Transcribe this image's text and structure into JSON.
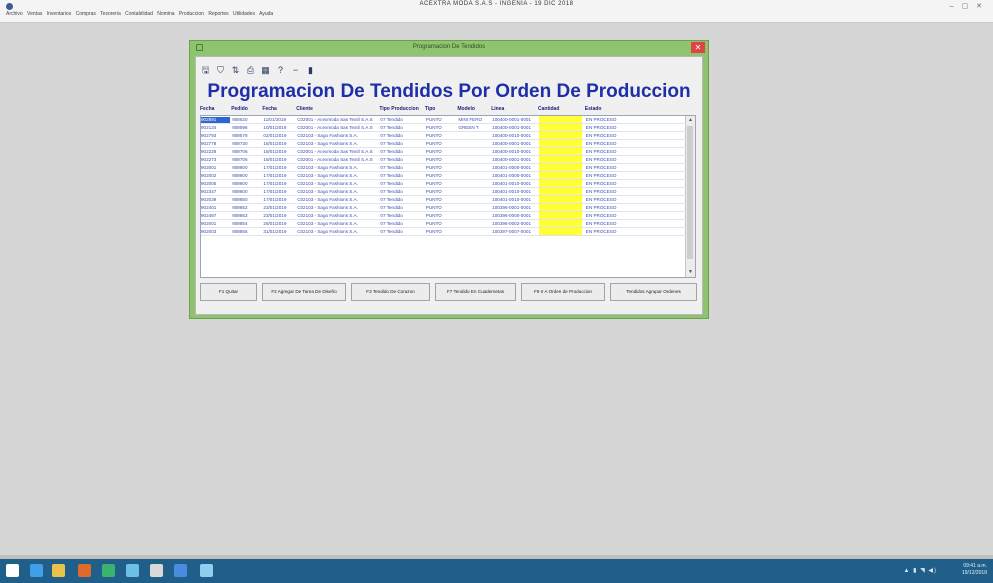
{
  "app": {
    "title": "ACEXTRA MODA  S.A.S    -    INGENIA           -    19 DIC 2018",
    "menu": "Archivo  Ventas  Inventarios  Compras  Tesoreria  Contabilidad  Nomina  Produccion  Reportes  Utilidades  Ayuda",
    "window_controls": "– ▢ ✕"
  },
  "window": {
    "title": "Programacion De Tendidos",
    "close_glyph": "✕"
  },
  "toolbar": {
    "tools": [
      {
        "icon": "save-icon",
        "glyph": "🖫"
      },
      {
        "icon": "filter-icon",
        "glyph": "⛉"
      },
      {
        "icon": "sort-icon",
        "glyph": "⇅"
      },
      {
        "icon": "print-icon",
        "glyph": "⎙"
      },
      {
        "icon": "preview-icon",
        "glyph": "▦"
      },
      {
        "icon": "help-icon",
        "glyph": "?"
      },
      {
        "icon": "minus-icon",
        "glyph": "−"
      },
      {
        "icon": "exit-icon",
        "glyph": "▮"
      }
    ]
  },
  "heading": "Programacion De Tendidos Por Orden De Produccion",
  "table": {
    "columns": [
      "Fecha",
      "Pedido",
      "Fecha",
      "Cliente",
      "Tipo Produccion",
      "Tipo",
      "Modelo",
      "Linea",
      "Cantidad",
      "Estado"
    ],
    "rows": [
      [
        "902891",
        "908620",
        "11/01/2019",
        "C02001 - Acexmoda Sas Textil S.A.S",
        "07 Tendido",
        "PUNTO",
        "MINI FERO",
        "100400-0001-0001",
        "",
        "EN PROCESO"
      ],
      [
        "902134",
        "908596",
        "10/01/2019",
        "C02001 - Acexmoda Sas Textil S.A.S",
        "07 Tendido",
        "PUNTO",
        "GREEN T",
        "100400-0001-0001",
        "",
        "EN PROCESO"
      ],
      [
        "902793",
        "908578",
        "02/01/2019",
        "C02103 - Sago Fashions S.A.",
        "07 Tendido",
        "PUNTO",
        "",
        "100400-0010-0001",
        "",
        "EN PROCESO"
      ],
      [
        "902778",
        "908730",
        "18/01/2019",
        "C02103 - Sago Fashions S.A.",
        "07 Tendido",
        "PUNTO",
        "",
        "100400-0001-0001",
        "",
        "EN PROCESO"
      ],
      [
        "902228",
        "908706",
        "18/01/2019",
        "C02001 - Acexmoda Sas Textil S.A.S",
        "07 Tendido",
        "PUNTO",
        "",
        "100400-0010-0001",
        "",
        "EN PROCESO"
      ],
      [
        "902273",
        "908706",
        "18/01/2019",
        "C02001 - Acexmoda Sas Textil S.A.S",
        "07 Tendido",
        "PUNTO",
        "",
        "100400-0001-0001",
        "",
        "EN PROCESO"
      ],
      [
        "902001",
        "908800",
        "17/01/2019",
        "C02103 - Sago Fashions S.A.",
        "07 Tendido",
        "PUNTO",
        "",
        "100401-0000-0001",
        "",
        "EN PROCESO"
      ],
      [
        "902002",
        "908800",
        "17/01/2019",
        "C02103 - Sago Fashions S.A.",
        "07 Tendido",
        "PUNTO",
        "",
        "100401-0000-0001",
        "",
        "EN PROCESO"
      ],
      [
        "902005",
        "908800",
        "17/01/2019",
        "C02103 - Sago Fashions S.A.",
        "07 Tendido",
        "PUNTO",
        "",
        "100401-0010-0001",
        "",
        "EN PROCESO"
      ],
      [
        "902347",
        "908800",
        "17/01/2019",
        "C02103 - Sago Fashions S.A.",
        "07 Tendido",
        "PUNTO",
        "",
        "100401-0010-0001",
        "",
        "EN PROCESO"
      ],
      [
        "902039",
        "908850",
        "17/01/2019",
        "C02103 - Sago Fashions S.A.",
        "07 Tendido",
        "PUNTO",
        "",
        "100401-0010-0001",
        "",
        "EN PROCESO"
      ],
      [
        "902401",
        "908852",
        "23/01/2019",
        "C02103 - Sago Fashions S.A.",
        "07 Tendido",
        "PUNTO",
        "",
        "100396-0001-0001",
        "",
        "EN PROCESO"
      ],
      [
        "902487",
        "908853",
        "23/01/2019",
        "C02103 - Sago Fashions S.A.",
        "07 Tendido",
        "PUNTO",
        "",
        "100396-0000-0001",
        "",
        "EN PROCESO"
      ],
      [
        "902001",
        "908854",
        "28/01/2019",
        "C02103 - Sago Fashions S.A.",
        "07 Tendido",
        "PUNTO",
        "",
        "100396-0002-0001",
        "",
        "EN PROCESO"
      ],
      [
        "902003",
        "908855",
        "31/01/2019",
        "C02103 - Sago Fashions S.A.",
        "07 Tendido",
        "PUNTO",
        "",
        "100397-0007-0001",
        "",
        "EN PROCESO"
      ]
    ]
  },
  "buttons": [
    "F1 Quitar",
    "F2 Agregar De Tarea De Diseño",
    "F3 Tendido De Corazon",
    "F7 Tendido En Cuadernetas",
    "F9 Ir A Orden de Produccion",
    "Tendidos Agrupar Ordenes"
  ],
  "taskbar": {
    "apps": [
      {
        "icon": "start-icon",
        "color": "#ffffff"
      },
      {
        "icon": "ie-icon",
        "color": "#3fa0e8"
      },
      {
        "icon": "explorer-icon",
        "color": "#e8c24a"
      },
      {
        "icon": "media-icon",
        "color": "#e06a2b"
      },
      {
        "icon": "app-icon",
        "color": "#3ab36e"
      },
      {
        "icon": "network-icon",
        "color": "#6cc0e8"
      },
      {
        "icon": "chrome-icon",
        "color": "#d9d9d9"
      },
      {
        "icon": "remote-icon",
        "color": "#4b8be0"
      },
      {
        "icon": "window-icon",
        "color": "#8fd0ee"
      }
    ],
    "tray": "▲ ▮ ◥ ◀)",
    "time": "09:41 a.m.",
    "date": "19/12/2018"
  }
}
